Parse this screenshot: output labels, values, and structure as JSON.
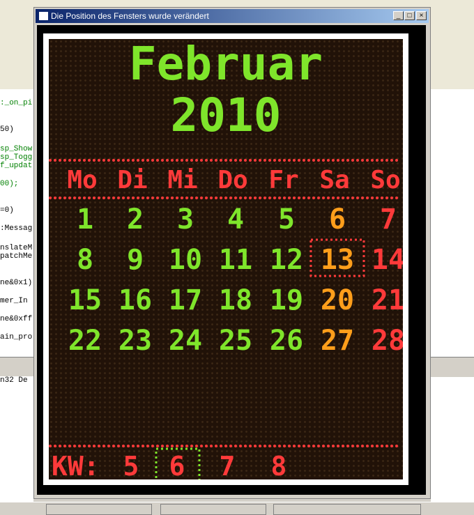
{
  "window": {
    "title": "Die Position des Fensters wurde verändert",
    "minimize_label": "_",
    "maximize_label": "□",
    "close_label": "×"
  },
  "colors": {
    "green": "#7fe52b",
    "red": "#ff3a3a",
    "orange": "#ff9e1b",
    "board": "#211208"
  },
  "calendar": {
    "month": "Februar",
    "year": "2010",
    "weekdays": [
      "Mo",
      "Di",
      "Mi",
      "Do",
      "Fr",
      "Sa",
      "So"
    ],
    "weeks": [
      [
        "",
        "1",
        "2",
        "3",
        "4",
        "5",
        "6",
        "7"
      ],
      [
        "",
        "8",
        "9",
        "10",
        "11",
        "12",
        "13",
        "14"
      ],
      [
        "",
        "15",
        "16",
        "17",
        "18",
        "19",
        "20",
        "21"
      ],
      [
        "",
        "22",
        "23",
        "24",
        "25",
        "26",
        "27",
        "28"
      ]
    ],
    "today": "13",
    "kw_label": "KW:",
    "calendar_weeks": [
      "5",
      "6",
      "7",
      "8"
    ],
    "current_kw": "6"
  },
  "ide_code_lines": [
    ":_on_pi",
    "50)",
    "sp_Show",
    "sp_Togg",
    "f_updat",
    "00);",
    "=0)",
    ":Messag",
    "nslateM",
    "patchMe",
    "ne&0x1)",
    "mer_In",
    "ne&0xff",
    "ain_pro"
  ],
  "ide_output_line": "n32 De"
}
